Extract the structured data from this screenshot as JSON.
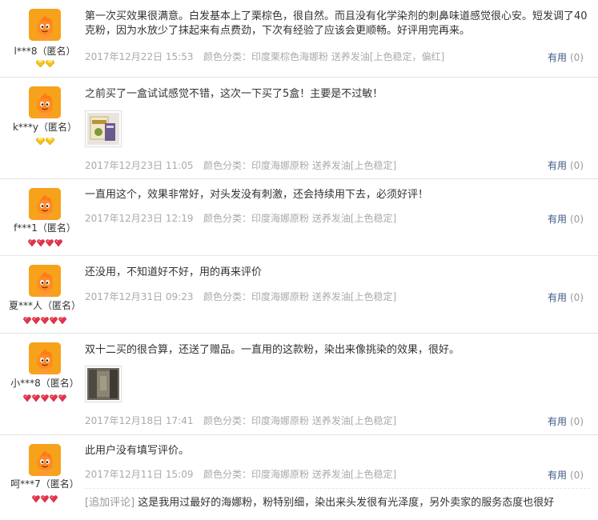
{
  "useful_label": "有用",
  "useful_count": "(0)",
  "append_tag": "[追加评论]",
  "reviews": [
    {
      "username": "l***8（匿名）",
      "rank": "yellow-2",
      "content": "第一次买效果很满意。白发基本上了栗棕色，很自然。而且没有化学染剂的刺鼻味道感觉很心安。短发调了40克粉，因为水放少了抹起来有点费劲，下次有经验了应该会更顺畅。好评用完再来。",
      "date": "2017年12月22日 15:53",
      "sku": "颜色分类：印度栗棕色海娜粉 送养发油[上色稳定，偏红]"
    },
    {
      "username": "k***y（匿名）",
      "rank": "yellow-2",
      "content": "之前买了一盒试试感觉不错，这次一下买了5盒！主要是不过敏！",
      "date": "2017年12月23日 11:05",
      "sku": "颜色分类：印度海娜原粉 送养发油[上色稳定]"
    },
    {
      "username": "f***1（匿名）",
      "rank": "red-4",
      "content": "一直用这个，效果非常好，对头发没有刺激，还会持续用下去，必须好评！",
      "date": "2017年12月23日 12:19",
      "sku": "颜色分类：印度海娜原粉 送养发油[上色稳定]"
    },
    {
      "username": "夏***人（匿名）",
      "rank": "red-5",
      "content": "还没用，不知道好不好，用的再来评价",
      "date": "2017年12月31日 09:23",
      "sku": "颜色分类：印度海娜原粉 送养发油[上色稳定]"
    },
    {
      "username": "小***8（匿名）",
      "rank": "red-5",
      "content": "双十二买的很合算，还送了赠品。一直用的这款粉，染出来像挑染的效果，很好。",
      "date": "2017年12月18日 17:41",
      "sku": "颜色分类：印度海娜原粉 送养发油[上色稳定]"
    },
    {
      "username": "呵***7（匿名）",
      "rank": "red-3",
      "content": "此用户没有填写评价。",
      "date": "2017年12月11日 15:09",
      "sku": "颜色分类：印度海娜原粉 送养发油[上色稳定]",
      "append": "这是我用过最好的海娜粉，粉特别细，染出来头发很有光泽度，另外卖家的服务态度也很好"
    }
  ],
  "colors": {
    "avatar_bg": "#f7a21b",
    "useful_link": "#3c5a8c",
    "meta_gray": "#aaaaaa",
    "gem_yellow": "#f5c518",
    "gem_red": "#e8324a"
  }
}
